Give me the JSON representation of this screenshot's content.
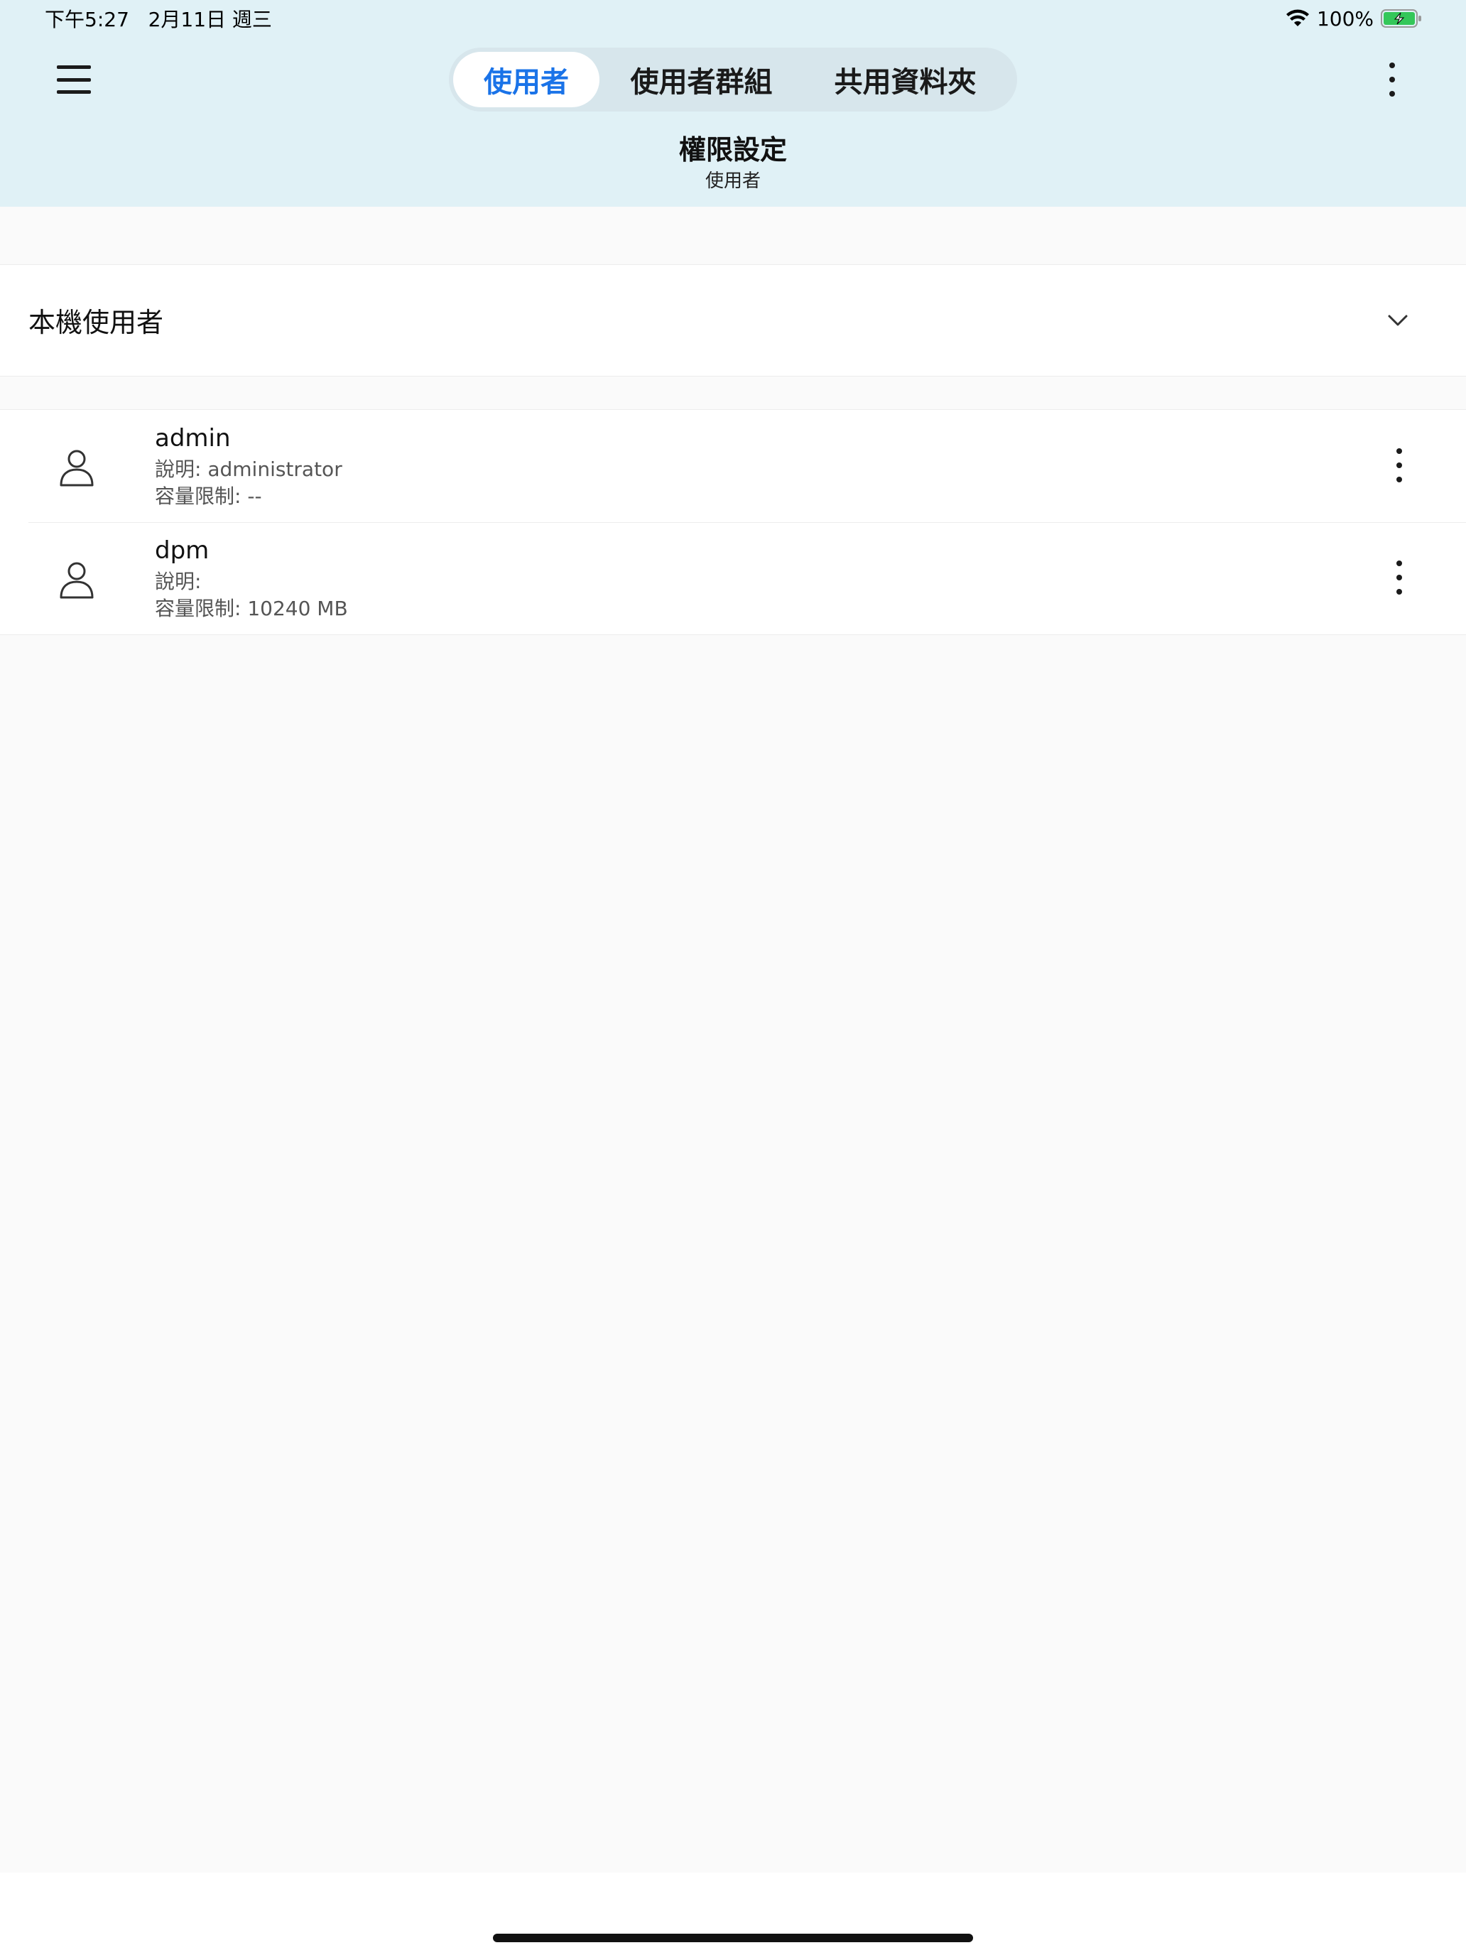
{
  "status_bar": {
    "time": "下午5:27   2月11日 週三",
    "battery": "100%"
  },
  "tabs": [
    {
      "label": "使用者",
      "active": true
    },
    {
      "label": "使用者群組",
      "active": false
    },
    {
      "label": "共用資料夾",
      "active": false
    }
  ],
  "header": {
    "title": "權限設定",
    "subtitle": "使用者"
  },
  "section": {
    "label": "本機使用者",
    "expanded": true
  },
  "users": [
    {
      "name": "admin",
      "description": "說明: administrator",
      "quota": "容量限制: --"
    },
    {
      "name": "dpm",
      "description": "說明:",
      "quota": "容量限制: 10240 MB"
    }
  ],
  "colors": {
    "header_bg": "#e0f1f6",
    "accent": "#1a73e8",
    "battery_green": "#34c759"
  },
  "icons": [
    "menu-icon",
    "more-vertical-icon",
    "chevron-down-icon",
    "user-icon",
    "wifi-icon",
    "battery-charging-icon"
  ]
}
